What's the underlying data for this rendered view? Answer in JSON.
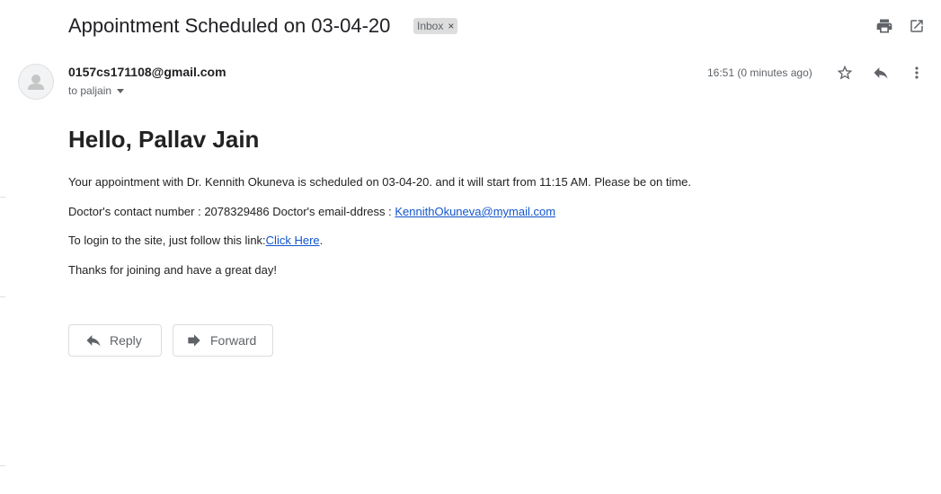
{
  "header": {
    "subject": "Appointment Scheduled on 03-04-20",
    "label_badge": "Inbox",
    "badge_close": "×"
  },
  "message": {
    "sender": "0157cs171108@gmail.com",
    "recipient": "to paljain",
    "time": "16:51 (0 minutes ago)",
    "greeting": "Hello, Pallav Jain",
    "para1": "Your appointment with Dr. Kennith Okuneva is scheduled on 03-04-20. and it will start from 11:15 AM. Please be on time.",
    "para2_prefix": "Doctor's contact number : 2078329486 Doctor's email-ddress : ",
    "para2_email": "KennithOkuneva@mymail.com",
    "para3_prefix": "To login to the site, just follow this link:",
    "para3_link": "Click Here",
    "para3_suffix": ".",
    "para4": "Thanks for joining and have a great day!"
  },
  "actions": {
    "reply": "Reply",
    "forward": "Forward"
  },
  "icons": {
    "print": "print-icon",
    "open_new_window": "open-in-new-icon",
    "star": "star-outline-icon",
    "reply": "reply-icon",
    "more": "more-vert-icon",
    "avatar": "person-icon",
    "dropdown": "caret-down-icon",
    "forward": "forward-icon"
  },
  "colors": {
    "link": "#1155cc",
    "text": "#202124",
    "muted": "#5f6368",
    "badge_bg": "#dddddd"
  }
}
